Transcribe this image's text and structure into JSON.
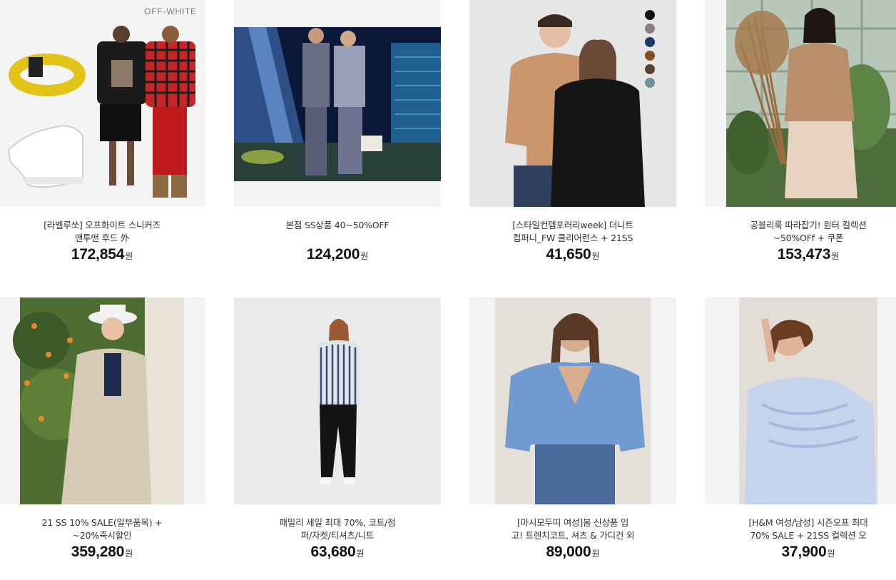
{
  "products": [
    {
      "title": "[라벨루쏘] 오프화이트 스니커즈\n맨투맨 후드 外",
      "price": "172,854",
      "currency": "원",
      "brand_mark": "OFF-WHITE"
    },
    {
      "title": "본점 SS상품 40~50%OFF",
      "price": "124,200",
      "currency": "원"
    },
    {
      "title": "[스타일컨템포러리week] 더니트\n컴퍼니_FW 클리어런스 + 21SS",
      "price": "41,650",
      "currency": "원",
      "swatches": [
        "#111111",
        "#8e7a83",
        "#1f3a68",
        "#8a4b27",
        "#5a4237",
        "#6f939a"
      ]
    },
    {
      "title": "공블리룩 따라잡기! 윈터 컬렉션\n~50%OFf + 쿠폰",
      "price": "153,473",
      "currency": "원"
    },
    {
      "title": "21 SS 10% SALE(일부품목) +\n~20%즉시할인",
      "price": "359,280",
      "currency": "원"
    },
    {
      "title": "패밀리 세일 최대 70%, 코트/점\n퍼/자켓/티셔츠/니트",
      "price": "63,680",
      "currency": "원"
    },
    {
      "title": "[마시모두띠 여성]봄 신상품 입\n고! 트렌치코트, 셔츠 & 가디건 외",
      "price": "89,000",
      "currency": "원"
    },
    {
      "title": "[H&M 여성/남성] 시즌오프 최대\n70% SALE + 21SS 컬렉션 오",
      "price": "37,900",
      "currency": "원"
    }
  ]
}
